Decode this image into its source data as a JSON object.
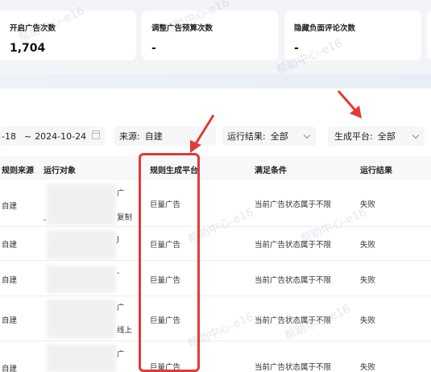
{
  "stats": [
    {
      "label": "开启广告次数",
      "value": "1,704"
    },
    {
      "label": "调整广告预算次数",
      "value": "-"
    },
    {
      "label": "隐藏负面评论次数",
      "value": "-"
    }
  ],
  "filters": {
    "date_start": "-18",
    "date_sep": "~",
    "date_end": "2024-10-24",
    "source_label": "来源:",
    "source_value": "自建",
    "run_label": "运行结果:",
    "run_value": "全部",
    "platform_label": "生成平台:",
    "platform_value": "全部"
  },
  "table": {
    "headers": {
      "source": "规则来源",
      "target": "运行对象",
      "platform": "规则生成平台",
      "condition": "满足条件",
      "result": "运行结果"
    },
    "rows": [
      {
        "source": "自建",
        "platform": "巨量广告",
        "condition": "当前广告状态属于不限",
        "result": "失败",
        "t1": "广",
        "t2": "-",
        "t3": "复制"
      },
      {
        "source": "自建",
        "platform": "巨量广告",
        "condition": "当前广告状态属于不限",
        "result": "失败",
        "t1": "J",
        "t2": "",
        "t3": ""
      },
      {
        "source": "自建",
        "platform": "巨量广告",
        "condition": "当前广告状态属于不限",
        "result": "失败",
        "t1": "-",
        "t2": "",
        "t3": ""
      },
      {
        "source": "自建",
        "platform": "巨量广告",
        "condition": "当前广告状态属于不限",
        "result": "失败",
        "t1": "广",
        "t2": "",
        "t3": "线上"
      },
      {
        "source": "自建",
        "platform": "巨量广告",
        "condition": "当前广告状态属于不限",
        "result": "失败",
        "t1": "广",
        "t2": "",
        "t3": ""
      }
    ]
  },
  "watermark": "帮助中心-e16",
  "colors": {
    "highlight": "#e53935",
    "bg": "#f3f4f7"
  }
}
